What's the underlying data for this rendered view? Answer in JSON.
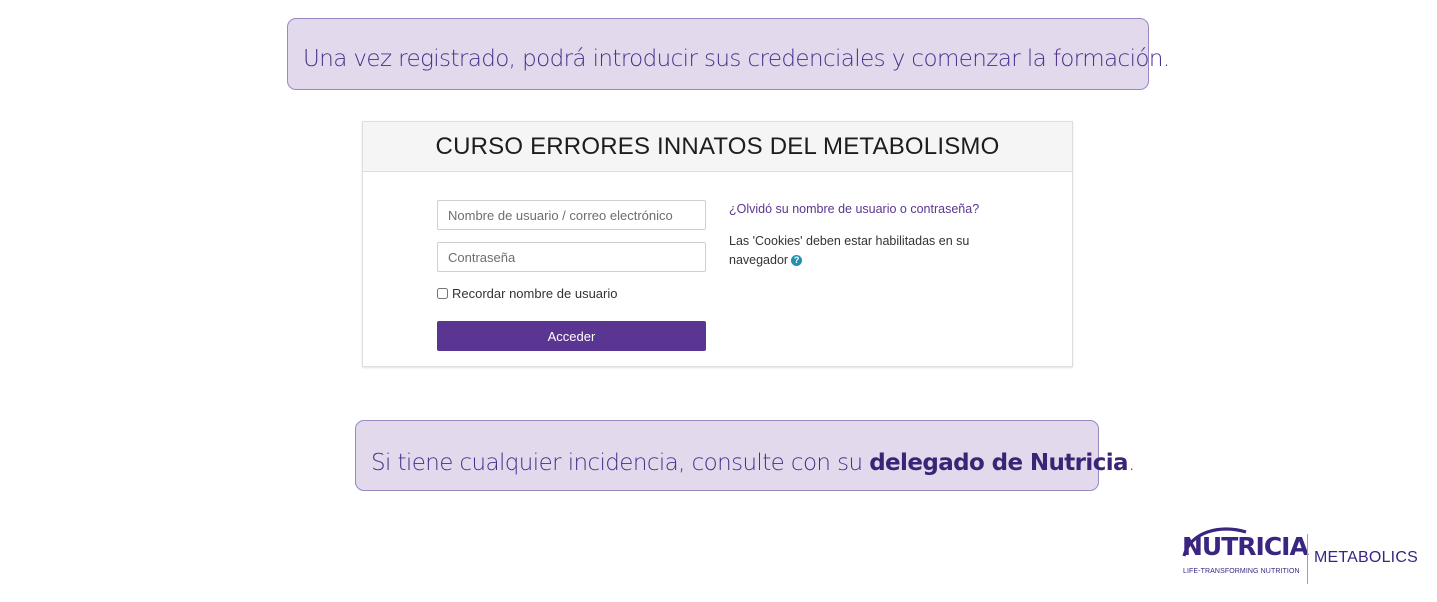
{
  "callouts": {
    "top_text": "Una vez registrado, podrá introducir sus credenciales y comenzar la formación.",
    "bottom_text_prefix": "Si tiene cualquier incidencia, consulte con su ",
    "bottom_text_bold": "delegado de Nutricia",
    "bottom_text_suffix": "."
  },
  "login": {
    "title": "CURSO ERRORES INNATOS DEL METABOLISMO",
    "username_placeholder": "Nombre de usuario / correo electrónico",
    "password_placeholder": "Contraseña",
    "remember_label": "Recordar nombre de usuario",
    "remember_checked": false,
    "submit_label": "Acceder",
    "forgot_link": "¿Olvidó su nombre de usuario o contraseña?",
    "cookies_note": "Las 'Cookies' deben estar habilitadas en su navegador",
    "help_icon": "question-circle-icon"
  },
  "brand": {
    "name": "NUTRICIA",
    "tagline": "LIFE-TRANSFORMING NUTRITION",
    "division": "METABOLICS"
  },
  "colors": {
    "callout_bg": "#e2daec",
    "callout_text": "#4a2e8a",
    "accent": "#5b3592",
    "brand": "#3a2580",
    "help_icon": "#1f91b1"
  }
}
